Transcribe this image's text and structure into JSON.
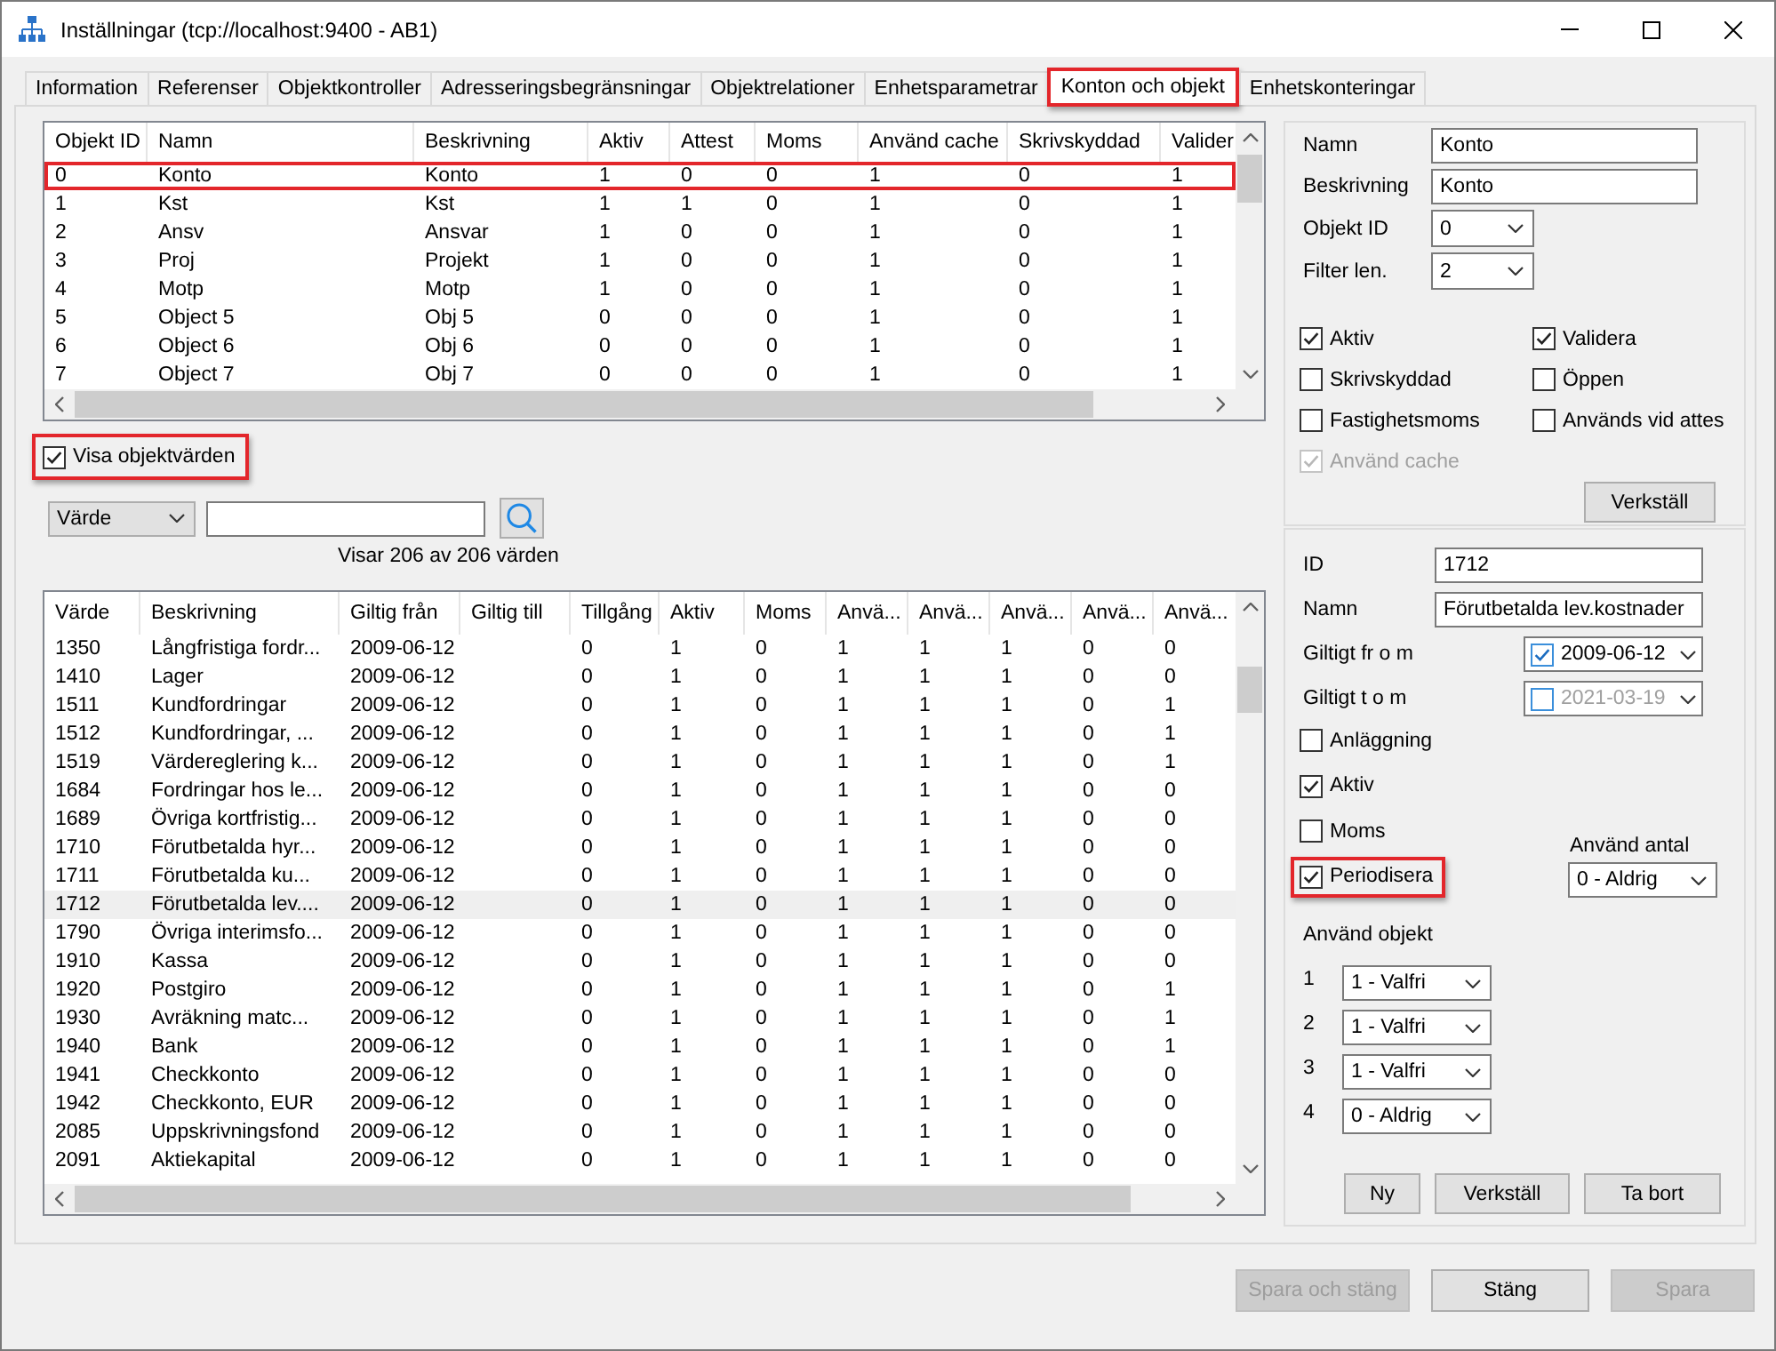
{
  "window": {
    "title": "Inställningar (tcp://localhost:9400 - AB1)"
  },
  "tabs": [
    {
      "label": "Information",
      "selected": false,
      "highlighted": false
    },
    {
      "label": "Referenser",
      "selected": false,
      "highlighted": false
    },
    {
      "label": "Objektkontroller",
      "selected": false,
      "highlighted": false
    },
    {
      "label": "Adresseringsbegränsningar",
      "selected": false,
      "highlighted": false
    },
    {
      "label": "Objektrelationer",
      "selected": false,
      "highlighted": false
    },
    {
      "label": "Enhetsparametrar",
      "selected": false,
      "highlighted": false
    },
    {
      "label": "Konton och objekt",
      "selected": true,
      "highlighted": true
    },
    {
      "label": "Enhetskonteringar",
      "selected": false,
      "highlighted": false
    }
  ],
  "objects_table": {
    "columns": [
      "Objekt ID",
      "Namn",
      "Beskrivning",
      "Aktiv",
      "Attest",
      "Moms",
      "Använd cache",
      "Skrivskyddad",
      "Valider"
    ],
    "rows": [
      {
        "cells": [
          "0",
          "Konto",
          "Konto",
          "1",
          "0",
          "0",
          "1",
          "0",
          "1"
        ],
        "highlighted": true
      },
      {
        "cells": [
          "1",
          "Kst",
          "Kst",
          "1",
          "1",
          "0",
          "1",
          "0",
          "1"
        ],
        "highlighted": false
      },
      {
        "cells": [
          "2",
          "Ansv",
          "Ansvar",
          "1",
          "0",
          "0",
          "1",
          "0",
          "1"
        ],
        "highlighted": false
      },
      {
        "cells": [
          "3",
          "Proj",
          "Projekt",
          "1",
          "0",
          "0",
          "1",
          "0",
          "1"
        ],
        "highlighted": false
      },
      {
        "cells": [
          "4",
          "Motp",
          "Motp",
          "1",
          "0",
          "0",
          "1",
          "0",
          "1"
        ],
        "highlighted": false
      },
      {
        "cells": [
          "5",
          "Object 5",
          "Obj 5",
          "0",
          "0",
          "0",
          "1",
          "0",
          "1"
        ],
        "highlighted": false
      },
      {
        "cells": [
          "6",
          "Object 6",
          "Obj 6",
          "0",
          "0",
          "0",
          "1",
          "0",
          "1"
        ],
        "highlighted": false
      },
      {
        "cells": [
          "7",
          "Object 7",
          "Obj 7",
          "0",
          "0",
          "0",
          "1",
          "0",
          "1"
        ],
        "highlighted": false
      }
    ]
  },
  "show_values": {
    "label": "Visa objektvärden",
    "checked": true,
    "highlighted": true
  },
  "filter": {
    "field": "Värde"
  },
  "count_text": "Visar 206 av 206 värden",
  "values_table": {
    "columns": [
      "Värde",
      "Beskrivning",
      "Giltig från",
      "Giltig till",
      "Tillgång",
      "Aktiv",
      "Moms",
      "Anvä...",
      "Anvä...",
      "Anvä...",
      "Anvä...",
      "Anvä..."
    ],
    "rows": [
      {
        "value": "1350",
        "description": "Långfristiga fordr...",
        "valid_from": "2009-06-12",
        "flags": [
          "0",
          "1",
          "0",
          "1",
          "1",
          "1",
          "0",
          "0"
        ],
        "selected": false
      },
      {
        "value": "1410",
        "description": "Lager",
        "valid_from": "2009-06-12",
        "flags": [
          "0",
          "1",
          "0",
          "1",
          "1",
          "1",
          "0",
          "0"
        ],
        "selected": false
      },
      {
        "value": "1511",
        "description": "Kundfordringar",
        "valid_from": "2009-06-12",
        "flags": [
          "0",
          "1",
          "0",
          "1",
          "1",
          "1",
          "0",
          "1"
        ],
        "selected": false
      },
      {
        "value": "1512",
        "description": "Kundfordringar, ...",
        "valid_from": "2009-06-12",
        "flags": [
          "0",
          "1",
          "0",
          "1",
          "1",
          "1",
          "0",
          "1"
        ],
        "selected": false
      },
      {
        "value": "1519",
        "description": "Värdereglering k...",
        "valid_from": "2009-06-12",
        "flags": [
          "0",
          "1",
          "0",
          "1",
          "1",
          "1",
          "0",
          "1"
        ],
        "selected": false
      },
      {
        "value": "1684",
        "description": "Fordringar hos le...",
        "valid_from": "2009-06-12",
        "flags": [
          "0",
          "1",
          "0",
          "1",
          "1",
          "1",
          "0",
          "0"
        ],
        "selected": false
      },
      {
        "value": "1689",
        "description": "Övriga kortfristig...",
        "valid_from": "2009-06-12",
        "flags": [
          "0",
          "1",
          "0",
          "1",
          "1",
          "1",
          "0",
          "0"
        ],
        "selected": false
      },
      {
        "value": "1710",
        "description": "Förutbetalda hyr...",
        "valid_from": "2009-06-12",
        "flags": [
          "0",
          "1",
          "0",
          "1",
          "1",
          "1",
          "0",
          "0"
        ],
        "selected": false
      },
      {
        "value": "1711",
        "description": "Förutbetalda ku...",
        "valid_from": "2009-06-12",
        "flags": [
          "0",
          "1",
          "0",
          "1",
          "1",
          "1",
          "0",
          "0"
        ],
        "selected": false
      },
      {
        "value": "1712",
        "description": "Förutbetalda lev....",
        "valid_from": "2009-06-12",
        "flags": [
          "0",
          "1",
          "0",
          "1",
          "1",
          "1",
          "0",
          "0"
        ],
        "selected": true
      },
      {
        "value": "1790",
        "description": "Övriga interimsfo...",
        "valid_from": "2009-06-12",
        "flags": [
          "0",
          "1",
          "0",
          "1",
          "1",
          "1",
          "0",
          "0"
        ],
        "selected": false
      },
      {
        "value": "1910",
        "description": "Kassa",
        "valid_from": "2009-06-12",
        "flags": [
          "0",
          "1",
          "0",
          "1",
          "1",
          "1",
          "0",
          "0"
        ],
        "selected": false
      },
      {
        "value": "1920",
        "description": "Postgiro",
        "valid_from": "2009-06-12",
        "flags": [
          "0",
          "1",
          "0",
          "1",
          "1",
          "1",
          "0",
          "1"
        ],
        "selected": false
      },
      {
        "value": "1930",
        "description": "Avräkning matc...",
        "valid_from": "2009-06-12",
        "flags": [
          "0",
          "1",
          "0",
          "1",
          "1",
          "1",
          "0",
          "1"
        ],
        "selected": false
      },
      {
        "value": "1940",
        "description": "Bank",
        "valid_from": "2009-06-12",
        "flags": [
          "0",
          "1",
          "0",
          "1",
          "1",
          "1",
          "0",
          "1"
        ],
        "selected": false
      },
      {
        "value": "1941",
        "description": "Checkkonto",
        "valid_from": "2009-06-12",
        "flags": [
          "0",
          "1",
          "0",
          "1",
          "1",
          "1",
          "0",
          "0"
        ],
        "selected": false
      },
      {
        "value": "1942",
        "description": "Checkkonto, EUR",
        "valid_from": "2009-06-12",
        "flags": [
          "0",
          "1",
          "0",
          "1",
          "1",
          "1",
          "0",
          "0"
        ],
        "selected": false
      },
      {
        "value": "2085",
        "description": "Uppskrivningsfond",
        "valid_from": "2009-06-12",
        "flags": [
          "0",
          "1",
          "0",
          "1",
          "1",
          "1",
          "0",
          "0"
        ],
        "selected": false
      },
      {
        "value": "2091",
        "description": "Aktiekapital",
        "valid_from": "2009-06-12",
        "flags": [
          "0",
          "1",
          "0",
          "1",
          "1",
          "1",
          "0",
          "0"
        ],
        "selected": false
      }
    ]
  },
  "object_panel": {
    "fields": [
      {
        "kind": "text",
        "label": "Namn",
        "value": "Konto"
      },
      {
        "kind": "text",
        "label": "Beskrivning",
        "value": "Konto"
      },
      {
        "kind": "dropdown",
        "label": "Objekt ID",
        "value": "0"
      },
      {
        "kind": "dropdown",
        "label": "Filter len.",
        "value": "2"
      }
    ],
    "checkboxes": [
      {
        "label": "Aktiv",
        "checked": true,
        "disabled": false
      },
      {
        "label": "Validera",
        "checked": true,
        "disabled": false
      },
      {
        "label": "Skrivskyddad",
        "checked": false,
        "disabled": false
      },
      {
        "label": "Öppen",
        "checked": false,
        "disabled": false
      },
      {
        "label": "Fastighetsmoms",
        "checked": false,
        "disabled": false
      },
      {
        "label": "Används vid attes",
        "checked": false,
        "disabled": false
      },
      {
        "label": "Använd cache",
        "checked": true,
        "disabled": true
      }
    ],
    "apply_button": "Verkställ"
  },
  "value_panel": {
    "fields": [
      {
        "kind": "text",
        "label": "ID",
        "value": "1712"
      },
      {
        "kind": "text",
        "label": "Namn",
        "value": "Förutbetalda lev.kostnader"
      },
      {
        "kind": "date",
        "label": "Giltigt fr o m",
        "value": "2009-06-12",
        "checked": true
      },
      {
        "kind": "date",
        "label": "Giltigt t o m",
        "value": "2021-03-19",
        "checked": false
      }
    ],
    "checkboxes": [
      {
        "label": "Anläggning",
        "checked": false,
        "highlighted": false
      },
      {
        "label": "Aktiv",
        "checked": true,
        "highlighted": false
      },
      {
        "label": "Moms",
        "checked": false,
        "highlighted": false
      },
      {
        "label": "Periodisera",
        "checked": true,
        "highlighted": true
      }
    ],
    "use_count": {
      "label": "Använd antal",
      "value": "0 - Aldrig"
    },
    "use_objects": {
      "label": "Använd objekt",
      "rows": [
        {
          "number": "1",
          "value": "1 - Valfri"
        },
        {
          "number": "2",
          "value": "1 - Valfri"
        },
        {
          "number": "3",
          "value": "1 - Valfri"
        },
        {
          "number": "4",
          "value": "0 - Aldrig"
        }
      ]
    },
    "buttons": [
      "Ny",
      "Verkställ",
      "Ta bort"
    ]
  },
  "footer_buttons": [
    {
      "label": "Spara och stäng",
      "disabled": true
    },
    {
      "label": "Stäng",
      "disabled": false
    },
    {
      "label": "Spara",
      "disabled": true
    }
  ]
}
